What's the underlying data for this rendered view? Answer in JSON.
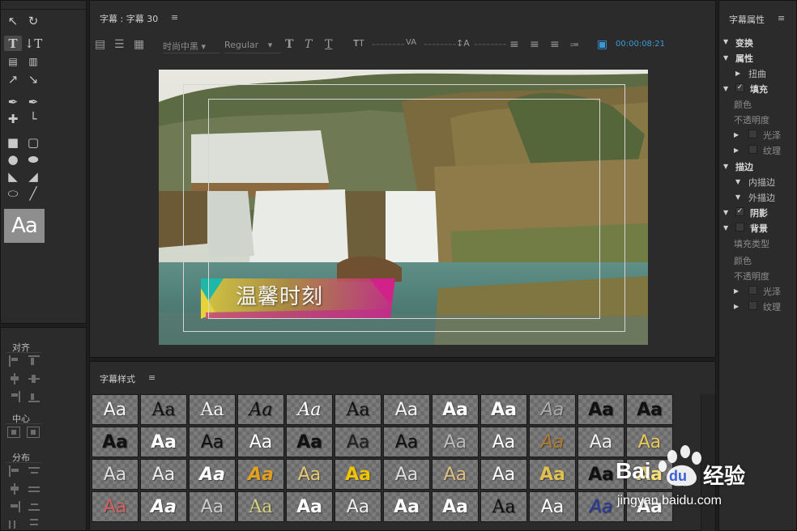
{
  "tools_panel": {
    "preview_text": "Aa",
    "align": {
      "label": "对齐"
    },
    "center": {
      "label": "中心"
    },
    "distribute": {
      "label": "分布"
    }
  },
  "editor": {
    "title": "字幕 : 字幕 30",
    "font_family": "时尚中黑",
    "font_style": "Regular",
    "timecode": "00:00:08:21",
    "canvas_text": "温馨时刻",
    "accent_colors": {
      "timecode": "#3a9ad9",
      "bar_pink": "#d2228a",
      "bar_teal": "#1fb8a8",
      "bar_yellow": "#e6d23a"
    }
  },
  "styles_panel": {
    "title": "字幕样式",
    "swatch_text": "Aa"
  },
  "properties": {
    "title": "字幕属性",
    "items": [
      {
        "label": "变换"
      },
      {
        "label": "属性"
      },
      {
        "label": "扭曲"
      },
      {
        "label": "填充",
        "checked": true
      },
      {
        "label": "颜色"
      },
      {
        "label": "不透明度"
      },
      {
        "label": "光泽"
      },
      {
        "label": "纹理"
      },
      {
        "label": "描边"
      },
      {
        "label": "内描边"
      },
      {
        "label": "外描边"
      },
      {
        "label": "阴影",
        "checked": true
      },
      {
        "label": "背景"
      },
      {
        "label": "填充类型"
      },
      {
        "label": "颜色"
      },
      {
        "label": "不透明度"
      },
      {
        "label": "光泽"
      },
      {
        "label": "纹理"
      }
    ],
    "checkmark": "✓"
  },
  "watermark": {
    "brand": "Bai",
    "brand2": "du",
    "cn": "经验",
    "url": "jingyan.baidu.com"
  }
}
